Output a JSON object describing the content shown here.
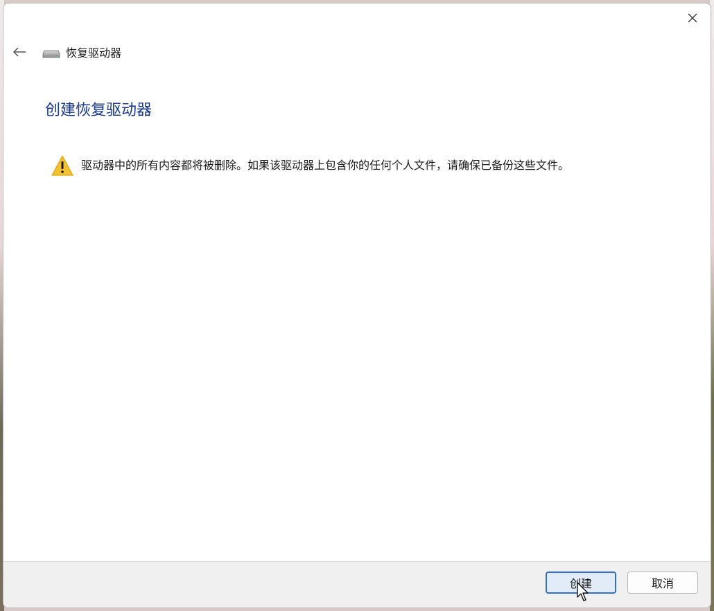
{
  "window": {
    "title": "恢复驱动器",
    "title_icon": "drive-icon",
    "close_icon": "close-icon",
    "back_icon": "back-arrow-icon"
  },
  "main": {
    "heading": "创建恢复驱动器",
    "warning_icon": "warning-icon",
    "warning_text": "驱动器中的所有内容都将被删除。如果该驱动器上包含你的任何个人文件，请确保已备份这些文件。"
  },
  "footer": {
    "create_label": "创建",
    "cancel_label": "取消"
  },
  "colors": {
    "heading": "#1c3a8c",
    "primary_button_border": "#2f6fc4",
    "primary_button_bg": "#e1ecf8",
    "warning_yellow": "#f2c233",
    "footer_bg": "#f0f0f0"
  }
}
